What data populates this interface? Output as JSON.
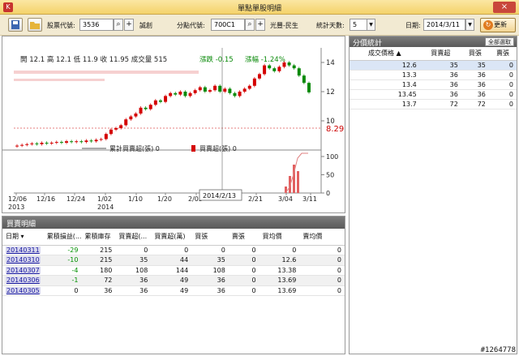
{
  "window": {
    "title": "單點單股明細",
    "close": "×"
  },
  "toolbar": {
    "stock_label": "股票代號:",
    "stock_value": "3536",
    "stock_name": "誠創",
    "branch_label": "分點代號:",
    "branch_value": "700C1",
    "branch_name": "光豐-民生",
    "days_label": "統計天數:",
    "days_value": "5",
    "date_label": "日期:",
    "date_value": "2014/3/11",
    "refresh": "更新"
  },
  "chart": {
    "quote_line": "開 12.1  高 12.1  低 11.9  收 11.95  成交量 515",
    "change": "漲跌 -0.15",
    "change_pct": "漲幅 -1.24%",
    "price_marker": "8.29",
    "price_ticks": [
      "14",
      "12",
      "10"
    ],
    "volume_ticks": [
      "100",
      "50",
      "0"
    ],
    "legend_cum": "累計買賣超(張) 0",
    "legend_net": "買賣超(張) 0",
    "cursor_date": "2014/2/13",
    "x_ticks": [
      "12/06",
      "12/16",
      "12/24",
      "1/02",
      "1/10",
      "1/20",
      "2/05",
      "2/21",
      "3/04",
      "3/11"
    ],
    "x_years": [
      "2013",
      "2014"
    ],
    "up_color": "#d40000",
    "down_color": "#0a8a0a"
  },
  "chart_data": {
    "type": "candlestick",
    "ylim": [
      8,
      15
    ],
    "closes": [
      8.3,
      8.35,
      8.4,
      8.45,
      8.4,
      8.5,
      8.45,
      8.5,
      8.55,
      8.5,
      8.6,
      8.55,
      8.6,
      8.55,
      8.65,
      8.6,
      8.7,
      8.75,
      9.1,
      9.4,
      9.5,
      9.7,
      10.1,
      10.3,
      10.5,
      10.9,
      10.8,
      11.1,
      11.4,
      11.3,
      11.7,
      11.9,
      11.8,
      12.0,
      11.7,
      11.9,
      12.1,
      12.3,
      12.0,
      12.1,
      12.4,
      12.0,
      12.2,
      11.9,
      11.7,
      12.0,
      12.2,
      12.4,
      12.9,
      13.2,
      13.8,
      13.6,
      13.4,
      13.7,
      14.0,
      13.8,
      13.6,
      13.1,
      12.6,
      11.95
    ]
  },
  "detail": {
    "title": "買賣明細",
    "columns": [
      "日期",
      "累積損益(...",
      "累積庫存",
      "買賣超(...",
      "買賣超(萬)",
      "買張",
      "賣張",
      "買均價",
      "賣均價"
    ],
    "rows": [
      [
        "20140311",
        "-29",
        "215",
        "0",
        "0",
        "0",
        "0",
        "0",
        "0"
      ],
      [
        "20140310",
        "-10",
        "215",
        "35",
        "44",
        "35",
        "0",
        "12.6",
        "0"
      ],
      [
        "20140307",
        "-4",
        "180",
        "108",
        "144",
        "108",
        "0",
        "13.38",
        "0"
      ],
      [
        "20140306",
        "-1",
        "72",
        "36",
        "49",
        "36",
        "0",
        "13.69",
        "0"
      ],
      [
        "20140305",
        "0",
        "36",
        "36",
        "49",
        "36",
        "0",
        "13.69",
        "0"
      ]
    ]
  },
  "stats": {
    "title": "分價統計",
    "select_all": "全部選取",
    "columns": [
      "成交價格",
      "買賣超",
      "買張",
      "賣張"
    ],
    "rows": [
      [
        "12.6",
        "35",
        "35",
        "0"
      ],
      [
        "13.3",
        "36",
        "36",
        "0"
      ],
      [
        "13.4",
        "36",
        "36",
        "0"
      ],
      [
        "13.45",
        "36",
        "36",
        "0"
      ],
      [
        "13.7",
        "72",
        "72",
        "0"
      ]
    ]
  },
  "watermark": "#1264778"
}
